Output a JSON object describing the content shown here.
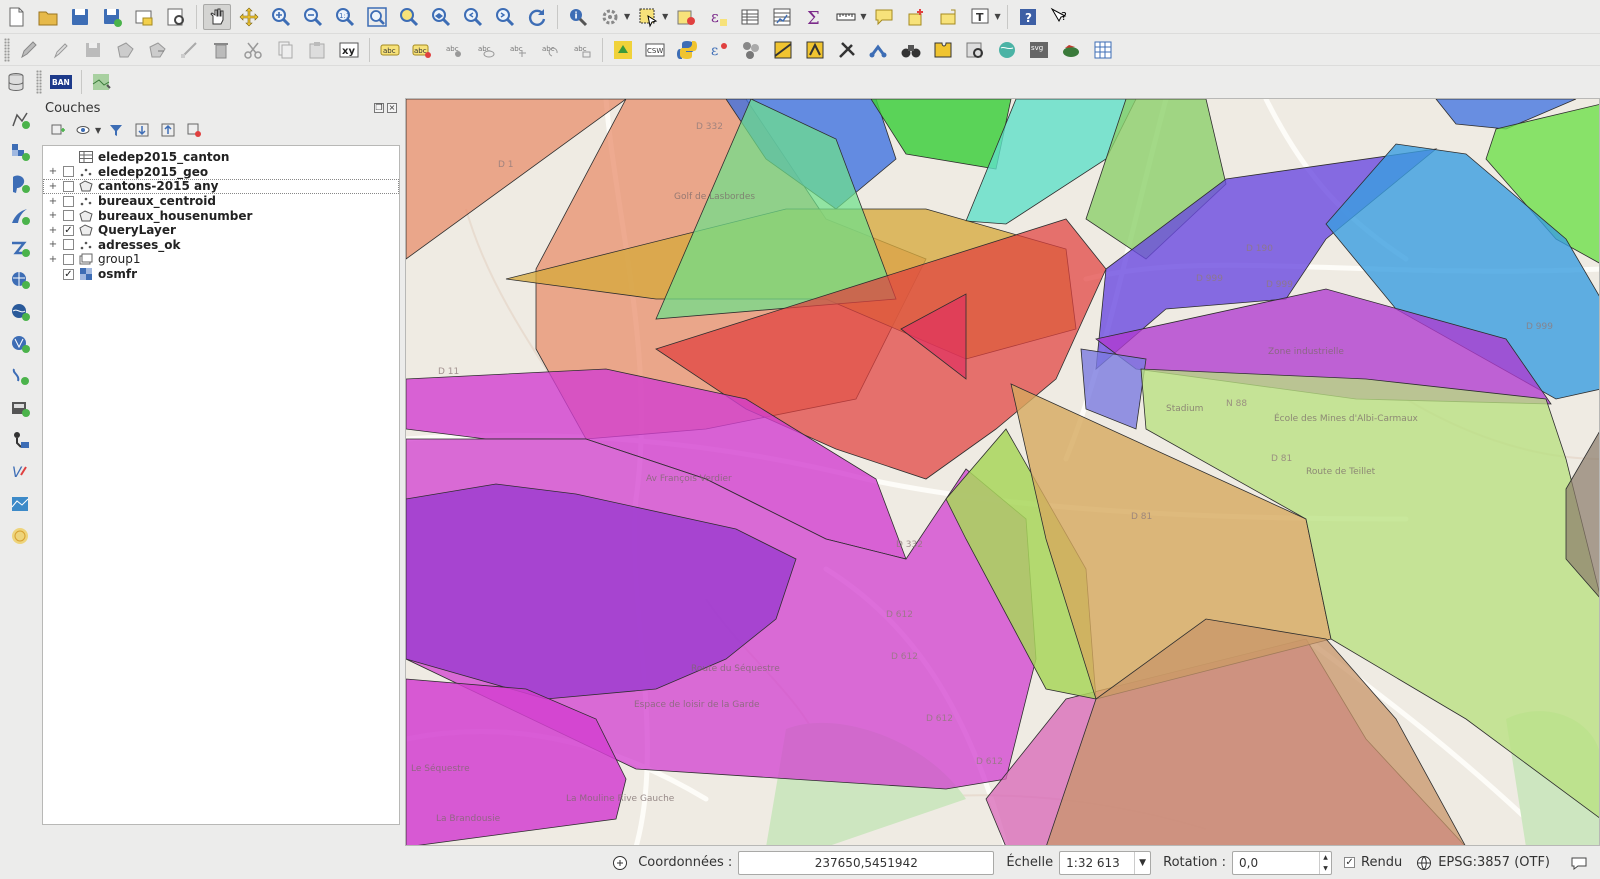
{
  "toolbar": {
    "row1": [
      {
        "name": "new-project-icon"
      },
      {
        "name": "open-project-icon"
      },
      {
        "name": "save-project-icon"
      },
      {
        "name": "save-as-icon"
      },
      {
        "name": "print-composer-icon"
      },
      {
        "name": "composer-manager-icon"
      },
      {
        "name": "pan-map-icon",
        "active": true
      },
      {
        "name": "pan-to-selection-icon"
      },
      {
        "name": "zoom-in-icon"
      },
      {
        "name": "zoom-out-icon"
      },
      {
        "name": "zoom-native-icon"
      },
      {
        "name": "zoom-full-icon"
      },
      {
        "name": "zoom-to-selection-icon"
      },
      {
        "name": "zoom-to-layer-icon"
      },
      {
        "name": "zoom-last-icon"
      },
      {
        "name": "zoom-next-icon"
      },
      {
        "name": "refresh-icon"
      },
      {
        "name": "identify-icon"
      },
      {
        "name": "run-feature-action-icon"
      },
      {
        "name": "select-features-icon"
      },
      {
        "name": "deselect-icon"
      },
      {
        "name": "expression-select-icon"
      },
      {
        "name": "attribute-table-icon"
      },
      {
        "name": "field-calculator-icon"
      },
      {
        "name": "statistics-icon"
      },
      {
        "name": "measure-icon"
      },
      {
        "name": "map-tips-icon"
      },
      {
        "name": "new-bookmark-icon"
      },
      {
        "name": "show-bookmarks-icon"
      },
      {
        "name": "text-annotation-icon"
      },
      {
        "name": "help-icon"
      },
      {
        "name": "whats-this-icon"
      }
    ]
  },
  "layers_panel": {
    "title": "Couches",
    "layers": [
      {
        "name": "eledep2015_canton",
        "bold": true,
        "checked": null,
        "expander": false,
        "icon": "table-icon"
      },
      {
        "name": "eledep2015_geo",
        "bold": true,
        "checked": false,
        "expander": true,
        "icon": "point-layer-icon"
      },
      {
        "name": "cantons-2015 any",
        "bold": true,
        "checked": false,
        "expander": true,
        "icon": "polygon-layer-icon",
        "selected": true
      },
      {
        "name": "bureaux_centroid",
        "bold": true,
        "checked": false,
        "expander": true,
        "icon": "point-layer-icon"
      },
      {
        "name": "bureaux_housenumber",
        "bold": true,
        "checked": false,
        "expander": true,
        "icon": "polygon-layer-icon"
      },
      {
        "name": "QueryLayer",
        "bold": true,
        "checked": true,
        "expander": true,
        "icon": "polygon-layer-icon"
      },
      {
        "name": "adresses_ok",
        "bold": true,
        "checked": false,
        "expander": true,
        "icon": "point-layer-icon"
      },
      {
        "name": "group1",
        "bold": false,
        "checked": false,
        "expander": true,
        "icon": "group-icon"
      },
      {
        "name": "osmfr",
        "bold": true,
        "checked": true,
        "expander": false,
        "icon": "raster-layer-icon"
      }
    ]
  },
  "map": {
    "road_labels": [
      "D 1",
      "D 11",
      "D 190",
      "D 999",
      "D 999",
      "D 999",
      "N 88",
      "D 332",
      "D 612",
      "D 612",
      "D 612",
      "D 612",
      "D 81",
      "D 81",
      "D 332"
    ],
    "place_labels": [
      "Golf de Lasbordes",
      "Stadium",
      "Zone industrielle",
      "École des Mines d'Albi-Carmaux",
      "Route de Teillet",
      "Espace de loisir de la Garde",
      "Route du Séquestre",
      "La Mouline Rive Gauche",
      "La Brandousie",
      "Av François Verdier",
      "Le Séquestre"
    ]
  },
  "status_bar": {
    "coord_label": "Coordonnées :",
    "coord_value": "237650,5451942",
    "scale_label": "Échelle",
    "scale_value": "1:32 613",
    "rotation_label": "Rotation :",
    "rotation_value": "0,0",
    "render_label": "Rendu",
    "render_checked": true,
    "crs_label": "EPSG:3857 (OTF)"
  },
  "colors": {
    "orange_salmon": "#e88a68",
    "purple_violet": "#9d3dcf",
    "magenta": "#d23fd0",
    "lime_green": "#a8d65a",
    "tan": "#d6a95e",
    "blue": "#3b6fe0",
    "red": "#e0403f",
    "teal": "#5fe0c8",
    "green": "#3fcf3f"
  }
}
